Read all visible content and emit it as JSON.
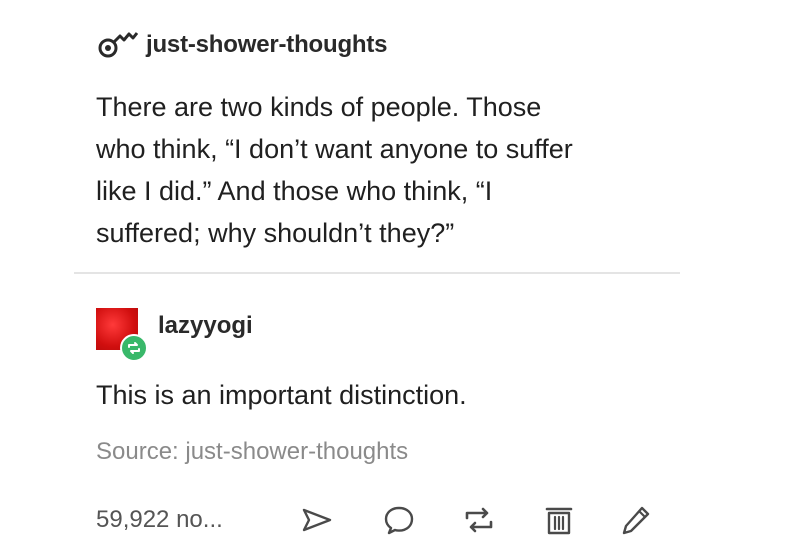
{
  "original_post": {
    "username": "just-shower-thoughts",
    "icon": "shower-head-icon",
    "lines": [
      "There are two kinds of people. Those",
      "who think, “I don’t want anyone to suffer",
      "like I did.” And those who think, “I",
      "suffered; why shouldn’t they?”"
    ]
  },
  "reblog": {
    "username": "lazyyogi",
    "avatar_color": "#d10f0f",
    "badge_color": "#39b86a",
    "comment": "This is an important distinction."
  },
  "source": {
    "text": "Source: just-shower-thoughts"
  },
  "footer": {
    "notes": "59,922 no...",
    "actions": [
      {
        "name": "share",
        "icon": "share-icon"
      },
      {
        "name": "reply",
        "icon": "reply-icon"
      },
      {
        "name": "reblog",
        "icon": "reblog-icon"
      },
      {
        "name": "delete",
        "icon": "trash-icon"
      },
      {
        "name": "edit",
        "icon": "pencil-icon"
      }
    ]
  }
}
